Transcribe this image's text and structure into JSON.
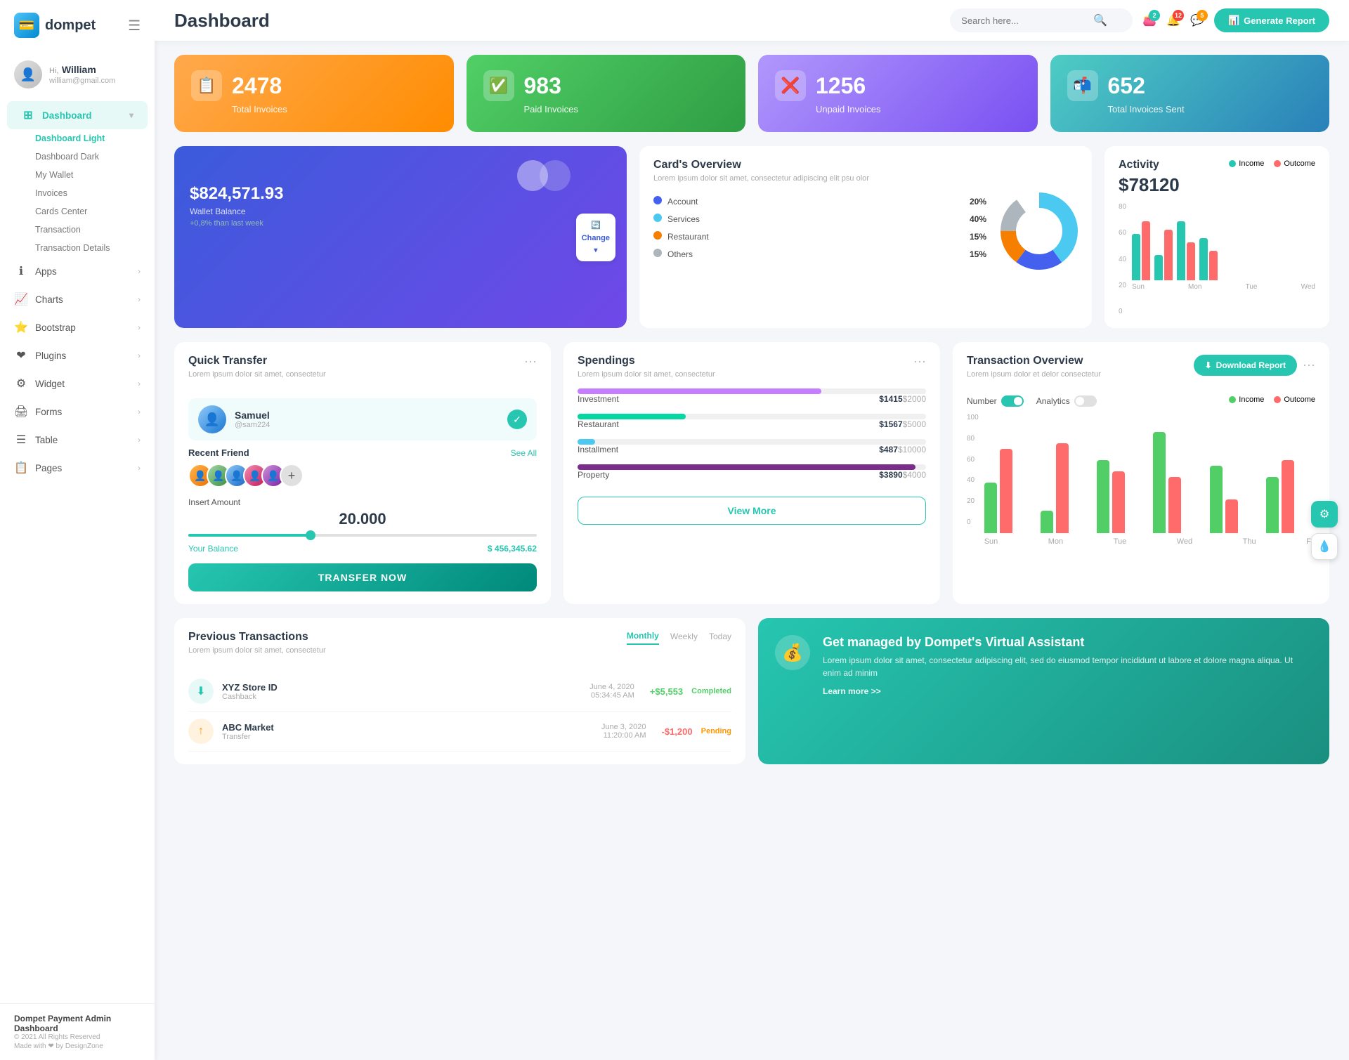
{
  "app": {
    "logo": "dompet",
    "logo_icon": "💳"
  },
  "user": {
    "greeting": "Hi,",
    "name": "William",
    "email": "william@gmail.com"
  },
  "sidebar": {
    "dashboard_label": "Dashboard",
    "sub_items": [
      {
        "label": "Dashboard Light",
        "active": true
      },
      {
        "label": "Dashboard Dark",
        "active": false
      },
      {
        "label": "My Wallet",
        "active": false
      },
      {
        "label": "Invoices",
        "active": false
      },
      {
        "label": "Cards Center",
        "active": false
      },
      {
        "label": "Transaction",
        "active": false
      },
      {
        "label": "Transaction Details",
        "active": false
      }
    ],
    "nav_items": [
      {
        "label": "Apps",
        "icon": "ℹ️"
      },
      {
        "label": "Charts",
        "icon": "📈"
      },
      {
        "label": "Bootstrap",
        "icon": "⭐"
      },
      {
        "label": "Plugins",
        "icon": "❤️"
      },
      {
        "label": "Widget",
        "icon": "⚙️"
      },
      {
        "label": "Forms",
        "icon": "🖨️"
      },
      {
        "label": "Table",
        "icon": "☰"
      },
      {
        "label": "Pages",
        "icon": "📋"
      }
    ],
    "footer_title": "Dompet Payment Admin Dashboard",
    "footer_copy": "© 2021 All Rights Reserved",
    "footer_made": "Made with ❤ by DesignZone"
  },
  "topbar": {
    "page_title": "Dashboard",
    "search_placeholder": "Search here...",
    "badges": {
      "wallet": "2",
      "bell": "12",
      "chat": "5"
    },
    "generate_btn": "Generate Report"
  },
  "stats": [
    {
      "number": "2478",
      "label": "Total Invoices",
      "icon": "📋",
      "color": "orange"
    },
    {
      "number": "983",
      "label": "Paid Invoices",
      "icon": "✅",
      "color": "green"
    },
    {
      "number": "1256",
      "label": "Unpaid Invoices",
      "icon": "❌",
      "color": "purple"
    },
    {
      "number": "652",
      "label": "Total Invoices Sent",
      "icon": "📋",
      "color": "teal"
    }
  ],
  "card_overview": {
    "balance": "$824,571.93",
    "balance_label": "Wallet Balance",
    "trend": "+0,8% than last week",
    "change_btn": "Change"
  },
  "donut": {
    "title": "Card's Overview",
    "subtitle": "Lorem ipsum dolor sit amet, consectetur adipiscing elit psu olor",
    "items": [
      {
        "label": "Account",
        "pct": "20%",
        "color": "#4361ee"
      },
      {
        "label": "Services",
        "pct": "40%",
        "color": "#4cc9f0"
      },
      {
        "label": "Restaurant",
        "pct": "15%",
        "color": "#f77f00"
      },
      {
        "label": "Others",
        "pct": "15%",
        "color": "#adb5bd"
      }
    ]
  },
  "activity": {
    "title": "Activity",
    "amount": "$78120",
    "income_label": "Income",
    "outcome_label": "Outcome",
    "bars": [
      {
        "day": "Sun",
        "income": 55,
        "outcome": 70
      },
      {
        "day": "Mon",
        "income": 30,
        "outcome": 60
      },
      {
        "day": "Tue",
        "income": 70,
        "outcome": 45
      },
      {
        "day": "Wed",
        "income": 50,
        "outcome": 35
      }
    ],
    "y_labels": [
      "80",
      "60",
      "40",
      "20",
      "0"
    ]
  },
  "quick_transfer": {
    "title": "Quick Transfer",
    "subtitle": "Lorem ipsum dolor sit amet, consectetur",
    "user_name": "Samuel",
    "user_handle": "@sam224",
    "recent_friends_label": "Recent Friend",
    "see_all": "See All",
    "amount_label": "Insert Amount",
    "amount_value": "20.000",
    "balance_label": "Your Balance",
    "balance_value": "$ 456,345.62",
    "transfer_btn": "TRANSFER NOW"
  },
  "spendings": {
    "title": "Spendings",
    "subtitle": "Lorem ipsum dolor sit amet, consectetur",
    "items": [
      {
        "label": "Investment",
        "amount": "$1415",
        "limit": "$2000",
        "pct": 70,
        "color": "#c77dff"
      },
      {
        "label": "Restaurant",
        "amount": "$1567",
        "limit": "$5000",
        "pct": 31,
        "color": "#06d6a0"
      },
      {
        "label": "Installment",
        "amount": "$487",
        "limit": "$10000",
        "pct": 5,
        "color": "#4cc9f0"
      },
      {
        "label": "Property",
        "amount": "$3890",
        "limit": "$4000",
        "pct": 97,
        "color": "#7b2d8b"
      }
    ],
    "view_more_btn": "View More"
  },
  "transaction_overview": {
    "title": "Transaction Overview",
    "subtitle": "Lorem ipsum dolor et delor consectetur",
    "download_btn": "Download Report",
    "number_label": "Number",
    "analytics_label": "Analytics",
    "income_label": "Income",
    "outcome_label": "Outcome",
    "bars": [
      {
        "day": "Sun",
        "income": 45,
        "outcome": 75
      },
      {
        "day": "Mon",
        "income": 20,
        "outcome": 80
      },
      {
        "day": "Tue",
        "income": 65,
        "outcome": 55
      },
      {
        "day": "Wed",
        "income": 90,
        "outcome": 50
      },
      {
        "day": "Thu",
        "income": 60,
        "outcome": 30
      },
      {
        "day": "Fri",
        "income": 50,
        "outcome": 65
      }
    ],
    "y_labels": [
      "100",
      "80",
      "60",
      "40",
      "20",
      "0"
    ]
  },
  "prev_transactions": {
    "title": "Previous Transactions",
    "subtitle": "Lorem ipsum dolor sit amet, consectetur",
    "tabs": [
      "Monthly",
      "Weekly",
      "Today"
    ],
    "active_tab": "Monthly",
    "items": [
      {
        "name": "XYZ Store ID",
        "type": "Cashback",
        "date": "June 4, 2020",
        "time": "05:34:45 AM",
        "amount": "+$5,553",
        "status": "Completed"
      }
    ]
  },
  "virtual_assistant": {
    "title": "Get managed by Dompet's Virtual Assistant",
    "desc": "Lorem ipsum dolor sit amet, consectetur adipiscing elit, sed do eiusmod tempor incididunt ut labore et dolore magna aliqua. Ut enim ad minim",
    "link": "Learn more >>"
  }
}
